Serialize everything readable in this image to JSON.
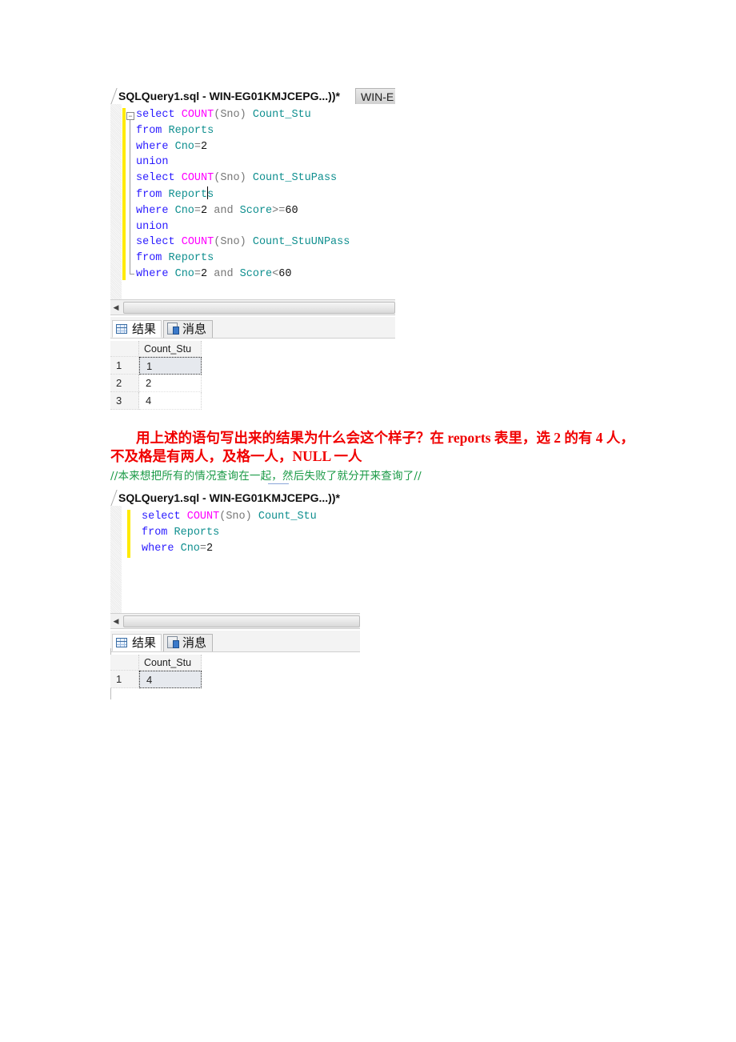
{
  "screenshot1": {
    "doc_tab_title": "SQLQuery1.sql - WIN-EG01KMJCEPG...))*",
    "second_tab_title": "WIN-E",
    "code_lines": [
      [
        {
          "t": "select ",
          "c": "kw"
        },
        {
          "t": "COUNT",
          "c": "fn"
        },
        {
          "t": "(Sno) ",
          "c": "op"
        },
        {
          "t": "Count_Stu",
          "c": "id"
        }
      ],
      [
        {
          "t": "from ",
          "c": "kw"
        },
        {
          "t": "Reports",
          "c": "id"
        }
      ],
      [
        {
          "t": "where ",
          "c": "kw"
        },
        {
          "t": "Cno",
          "c": "id"
        },
        {
          "t": "=",
          "c": "op"
        },
        {
          "t": "2",
          "c": "num"
        }
      ],
      [
        {
          "t": "union",
          "c": "kw"
        }
      ],
      [
        {
          "t": "select ",
          "c": "kw"
        },
        {
          "t": "COUNT",
          "c": "fn"
        },
        {
          "t": "(Sno) ",
          "c": "op"
        },
        {
          "t": "Count_StuPass",
          "c": "id"
        }
      ],
      [
        {
          "t": "from ",
          "c": "kw"
        },
        {
          "t": "Report",
          "c": "id"
        },
        {
          "t": "|",
          "c": "caret"
        },
        {
          "t": "s",
          "c": "id"
        }
      ],
      [
        {
          "t": "where ",
          "c": "kw"
        },
        {
          "t": "Cno",
          "c": "id"
        },
        {
          "t": "=",
          "c": "op"
        },
        {
          "t": "2",
          "c": "num"
        },
        {
          "t": " and ",
          "c": "op"
        },
        {
          "t": "Score",
          "c": "id"
        },
        {
          "t": ">=",
          "c": "op"
        },
        {
          "t": "60",
          "c": "num"
        }
      ],
      [
        {
          "t": "union",
          "c": "kw"
        }
      ],
      [
        {
          "t": "select ",
          "c": "kw"
        },
        {
          "t": "COUNT",
          "c": "fn"
        },
        {
          "t": "(Sno) ",
          "c": "op"
        },
        {
          "t": "Count_StuUNPass",
          "c": "id"
        }
      ],
      [
        {
          "t": "from ",
          "c": "kw"
        },
        {
          "t": "Reports",
          "c": "id"
        }
      ],
      [
        {
          "t": "where ",
          "c": "kw"
        },
        {
          "t": "Cno",
          "c": "id"
        },
        {
          "t": "=",
          "c": "op"
        },
        {
          "t": "2",
          "c": "num"
        },
        {
          "t": " and ",
          "c": "op"
        },
        {
          "t": "Score",
          "c": "id"
        },
        {
          "t": "<",
          "c": "op"
        },
        {
          "t": "60",
          "c": "num"
        }
      ]
    ],
    "scroll_left_icon": "scroll-left-arrow",
    "results_tab_label": "结果",
    "messages_tab_label": "消息",
    "grid_column_header": "Count_Stu",
    "grid_rows": [
      {
        "row_number": "1",
        "value": "1"
      },
      {
        "row_number": "2",
        "value": "2"
      },
      {
        "row_number": "3",
        "value": "4"
      }
    ]
  },
  "question_text": "用上述的语句写出来的结果为什么会这个样子？在 reports 表里，选 2 的有 4 人，不及格是有两人，及格一人，NULL 一人",
  "comment_text": "//本来想把所有的情况查询在一起，然后失败了就分开来查询了//",
  "screenshot2": {
    "doc_tab_title": "SQLQuery1.sql - WIN-EG01KMJCEPG...))*",
    "code_lines": [
      [
        {
          "t": "select ",
          "c": "kw"
        },
        {
          "t": "COUNT",
          "c": "fn"
        },
        {
          "t": "(Sno) ",
          "c": "op"
        },
        {
          "t": "Count_Stu",
          "c": "id"
        }
      ],
      [
        {
          "t": "from ",
          "c": "kw"
        },
        {
          "t": "Reports",
          "c": "id"
        }
      ],
      [
        {
          "t": "where ",
          "c": "kw"
        },
        {
          "t": "Cno",
          "c": "id"
        },
        {
          "t": "=",
          "c": "op"
        },
        {
          "t": "2",
          "c": "num"
        }
      ]
    ],
    "results_tab_label": "结果",
    "messages_tab_label": "消息",
    "grid_column_header": "Count_Stu",
    "grid_rows": [
      {
        "row_number": "1",
        "value": "4"
      }
    ]
  },
  "colors": {
    "keyword": "#2a1bff",
    "function": "#ff00ff",
    "identifier": "#0f8f8f",
    "operator": "#777777",
    "change_bar": "#ffea00",
    "question_text": "#f00000",
    "comment_text": "#1a9a46"
  }
}
